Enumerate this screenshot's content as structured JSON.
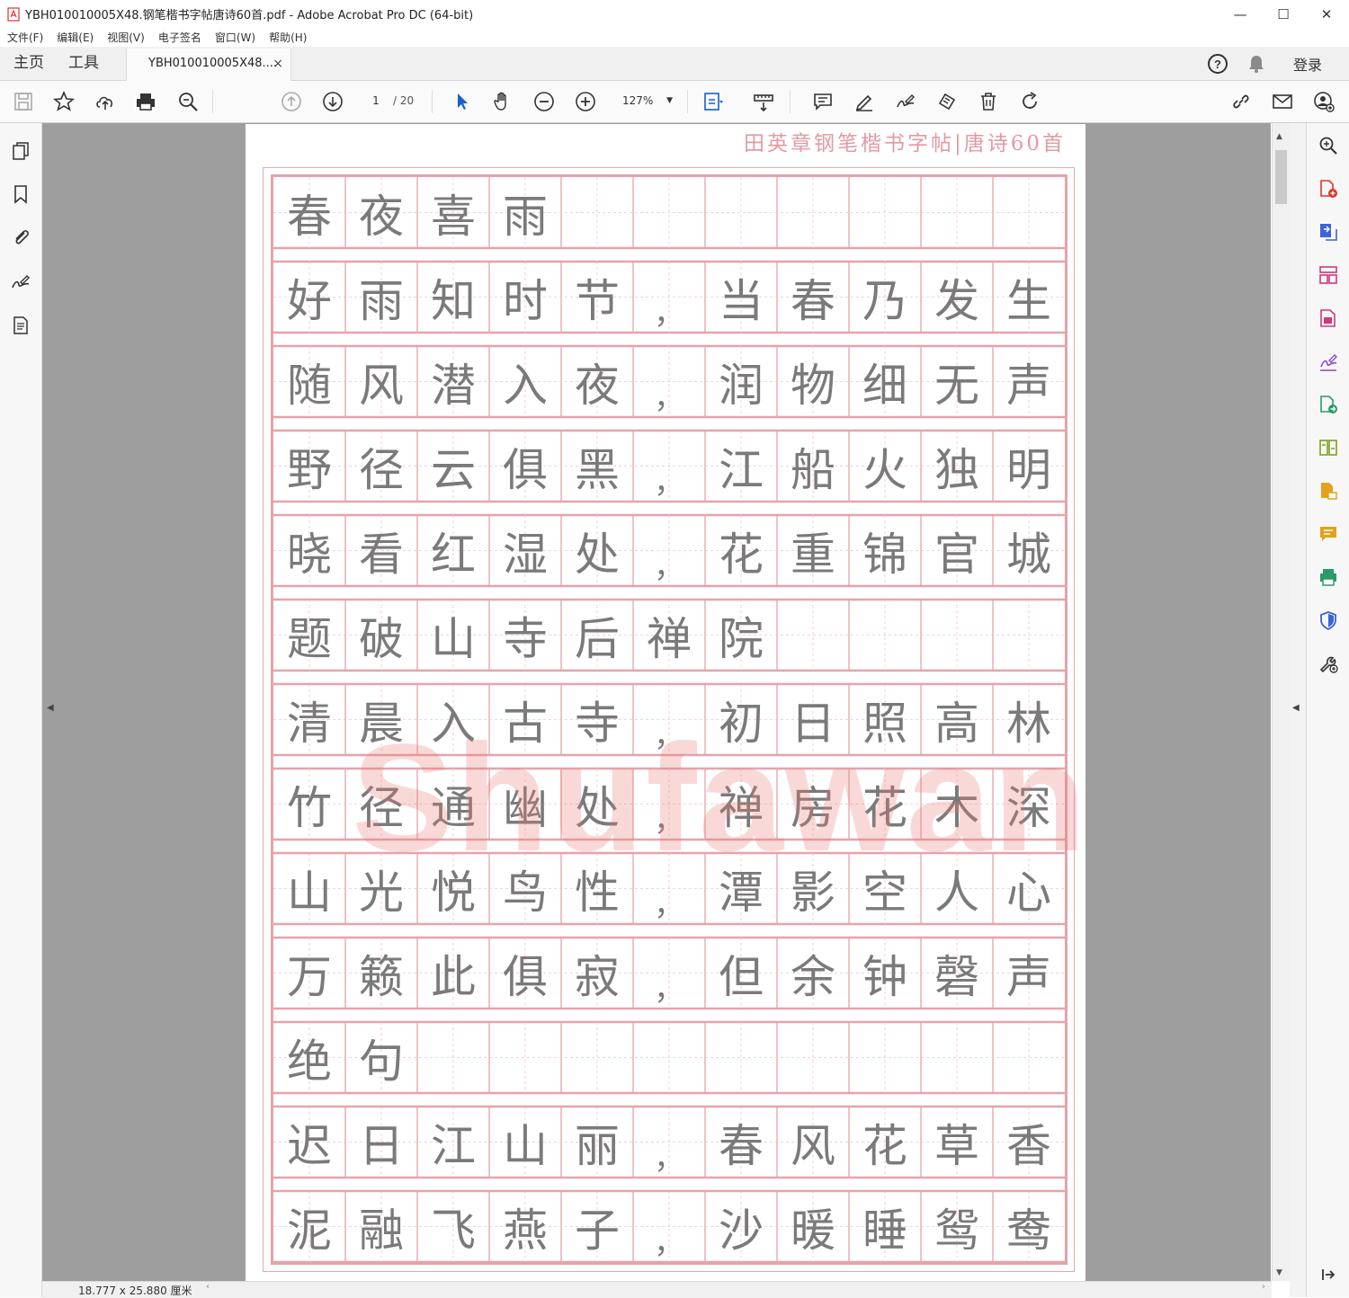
{
  "window": {
    "title": "YBH010010005X48.钢笔楷书字帖唐诗60首.pdf - Adobe Acrobat Pro DC (64-bit)",
    "controls": {
      "minimize": "—",
      "maximize": "☐",
      "close": "✕"
    }
  },
  "menu": [
    "文件(F)",
    "编辑(E)",
    "视图(V)",
    "电子签名",
    "窗口(W)",
    "帮助(H)"
  ],
  "tabs": {
    "home": "主页",
    "tools": "工具",
    "document": "YBH010010005X48....",
    "document_close": "×",
    "signin": "登录"
  },
  "toolbar": {
    "page_current": "1",
    "page_total": "/ 20",
    "zoom": "127%",
    "icons": [
      "save-icon",
      "bookmark-star-icon",
      "cloud-upload-icon",
      "print-icon",
      "search-zoom-icon",
      "page-up-icon",
      "page-down-icon",
      "select-pointer-icon",
      "hand-icon",
      "zoom-out-icon",
      "zoom-in-icon",
      "fit-page-icon",
      "measure-icon",
      "comment-icon",
      "highlight-pen-icon",
      "sign-icon",
      "stamp-icon",
      "delete-icon",
      "rotate-icon",
      "share-link-icon",
      "email-icon",
      "add-user-icon"
    ]
  },
  "document": {
    "header": "田英章钢笔楷书字帖|唐诗60首",
    "watermark": "Shufawang.CN",
    "rows": [
      [
        "春",
        "夜",
        "喜",
        "雨",
        "",
        "",
        "",
        "",
        "",
        "",
        ""
      ],
      [
        "好",
        "雨",
        "知",
        "时",
        "节",
        "，",
        "当",
        "春",
        "乃",
        "发",
        "生"
      ],
      [
        "随",
        "风",
        "潜",
        "入",
        "夜",
        "，",
        "润",
        "物",
        "细",
        "无",
        "声"
      ],
      [
        "野",
        "径",
        "云",
        "俱",
        "黑",
        "，",
        "江",
        "船",
        "火",
        "独",
        "明"
      ],
      [
        "晓",
        "看",
        "红",
        "湿",
        "处",
        "，",
        "花",
        "重",
        "锦",
        "官",
        "城"
      ],
      [
        "题",
        "破",
        "山",
        "寺",
        "后",
        "禅",
        "院",
        "",
        "",
        "",
        ""
      ],
      [
        "清",
        "晨",
        "入",
        "古",
        "寺",
        "，",
        "初",
        "日",
        "照",
        "高",
        "林"
      ],
      [
        "竹",
        "径",
        "通",
        "幽",
        "处",
        "，",
        "禅",
        "房",
        "花",
        "木",
        "深"
      ],
      [
        "山",
        "光",
        "悦",
        "鸟",
        "性",
        "，",
        "潭",
        "影",
        "空",
        "人",
        "心"
      ],
      [
        "万",
        "籁",
        "此",
        "俱",
        "寂",
        "，",
        "但",
        "余",
        "钟",
        "磬",
        "声"
      ],
      [
        "绝",
        "句",
        "",
        "",
        "",
        "",
        "",
        "",
        "",
        "",
        ""
      ],
      [
        "迟",
        "日",
        "江",
        "山",
        "丽",
        "，",
        "春",
        "风",
        "花",
        "草",
        "香"
      ],
      [
        "泥",
        "融",
        "飞",
        "燕",
        "子",
        "，",
        "沙",
        "暖",
        "睡",
        "鸳",
        "鸯"
      ]
    ]
  },
  "status": {
    "dimensions": "18.777 x 25.880 厘米"
  },
  "colors": {
    "grid_line": "#e7a2a9",
    "grid_inner": "#f0c4c8",
    "header_text": "#e39aa2",
    "char_text": "#7a7a7a",
    "viewer_bg": "#9e9e9e",
    "watermark": "#e8786e"
  }
}
